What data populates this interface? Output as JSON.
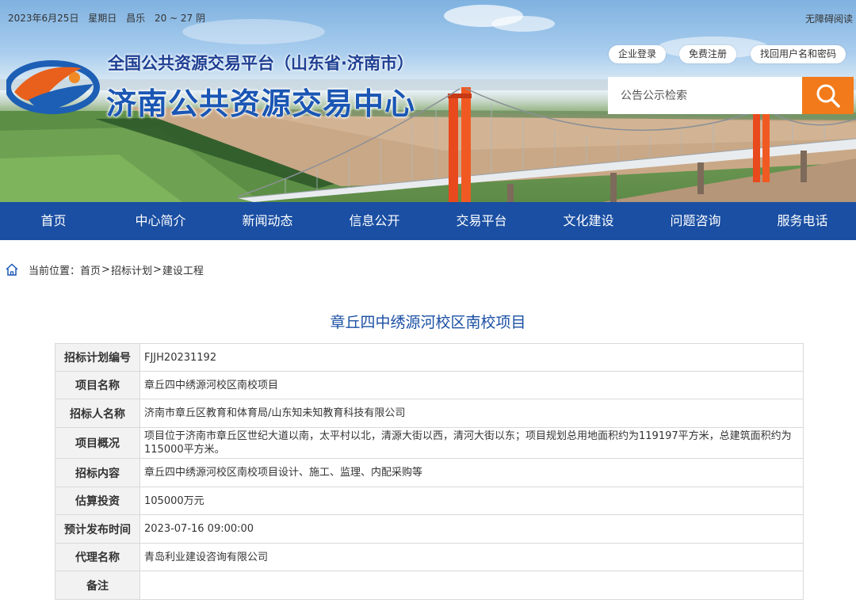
{
  "topbar": {
    "date": "2023年6月25日",
    "weekday": "星期日",
    "city": "昌乐",
    "weather": "20 ~ 27 阴",
    "accessibility": "无障碍阅读"
  },
  "header": {
    "title_small": "全国公共资源交易平台（山东省·济南市）",
    "title_large": "济南公共资源交易中心",
    "links": [
      "企业登录",
      "免费注册",
      "找回用户名和密码"
    ],
    "search_placeholder": "公告公示检索"
  },
  "nav": [
    "首页",
    "中心简介",
    "新闻动态",
    "信息公开",
    "交易平台",
    "文化建设",
    "问题咨询",
    "服务电话"
  ],
  "breadcrumb": {
    "prefix": "当前位置：",
    "items": [
      "首页",
      "招标计划",
      "建设工程"
    ],
    "separator": ">"
  },
  "page_title": "章丘四中绣源河校区南校项目",
  "table": [
    {
      "label": "招标计划编号",
      "value": "FJJH20231192"
    },
    {
      "label": "项目名称",
      "value": "章丘四中绣源河校区南校项目"
    },
    {
      "label": "招标人名称",
      "value": "济南市章丘区教育和体育局/山东知未知教育科技有限公司"
    },
    {
      "label": "项目概况",
      "value": "项目位于济南市章丘区世纪大道以南，太平村以北，清源大街以西，清河大街以东；项目规划总用地面积约为119197平方米，总建筑面积约为115000平方米。"
    },
    {
      "label": "招标内容",
      "value": "章丘四中绣源河校区南校项目设计、施工、监理、内配采购等"
    },
    {
      "label": "估算投资",
      "value": "105000万元"
    },
    {
      "label": "预计发布时间",
      "value": "2023-07-16 09:00:00"
    },
    {
      "label": "代理名称",
      "value": "青岛利业建设咨询有限公司"
    },
    {
      "label": "备注",
      "value": ""
    }
  ],
  "colors": {
    "nav_bg": "#1a4fa3",
    "title_blue": "#1a56b4",
    "search_button": "#f27a1a",
    "label_bg": "#f2f2f2"
  }
}
